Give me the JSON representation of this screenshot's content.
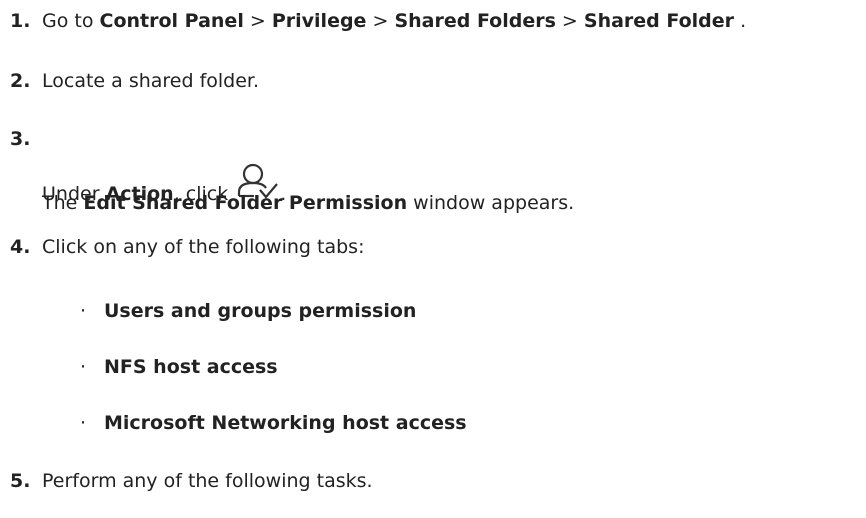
{
  "steps": {
    "s1": {
      "number": "1.",
      "pre": "Go to ",
      "b1": "Control Panel",
      "sep1": " > ",
      "b2": "Privilege",
      "sep2": " > ",
      "b3": "Shared Folders",
      "sep3": " > ",
      "b4": "Shared Folder",
      "post": " ."
    },
    "s2": {
      "number": "2.",
      "text": "Locate a shared folder."
    },
    "s3": {
      "number": "3.",
      "pre": "Under ",
      "bold": "Action",
      "mid": ", click ",
      "icon": "user-permission-icon",
      "post": ".",
      "line2_pre": "The ",
      "line2_bold": "Edit Shared Folder Permission",
      "line2_post": " window appears."
    },
    "s4": {
      "number": "4.",
      "text": "Click on any of the following tabs:",
      "bullets": [
        "Users and groups permission",
        "NFS host access",
        "Microsoft Networking host access"
      ]
    },
    "s5": {
      "number": "5.",
      "text": "Perform any of the following tasks."
    }
  }
}
